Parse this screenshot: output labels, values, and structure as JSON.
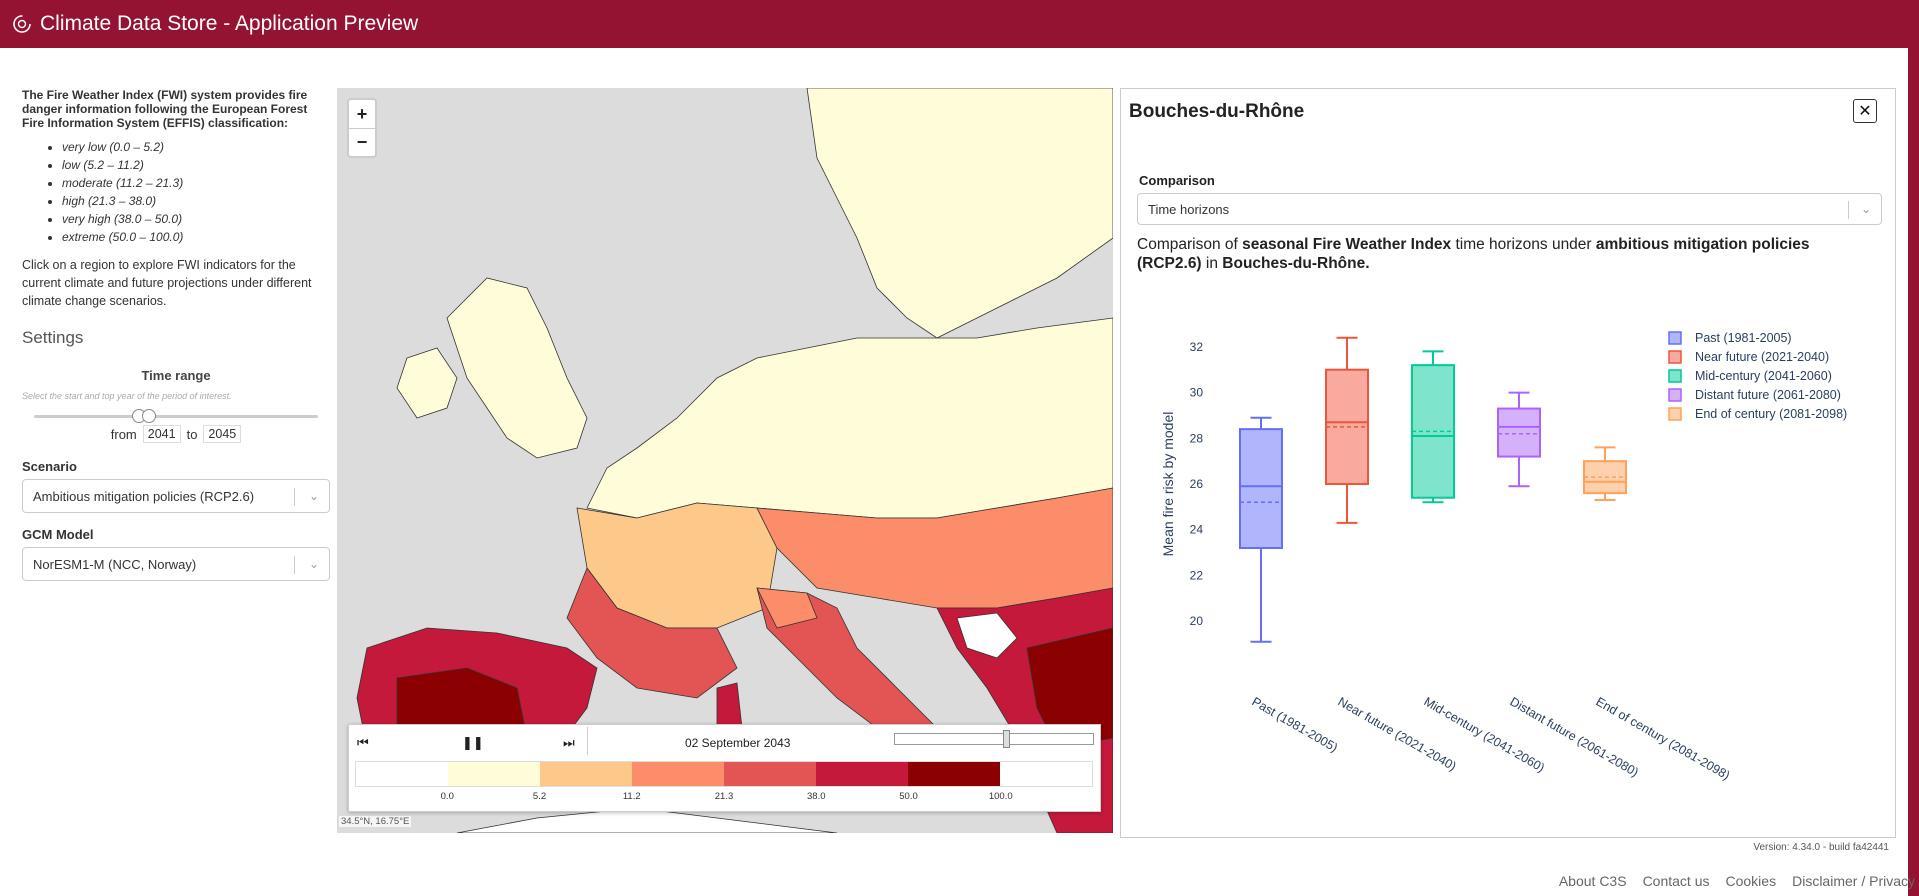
{
  "header": {
    "title": "Climate Data Store - Application Preview"
  },
  "sidebar": {
    "intro": "The Fire Weather Index (FWI) system provides fire danger information following the European Forest Fire Information System (EFFIS) classification:",
    "classes": [
      "very low (0.0 – 5.2)",
      "low (5.2 – 11.2)",
      "moderate (11.2 – 21.3)",
      "high (21.3 – 38.0)",
      "very high (38.0 – 50.0)",
      "extreme (50.0 – 100.0)"
    ],
    "click_text": "Click on a region to explore FWI indicators for the current climate and future projections under different climate change scenarios.",
    "settings_title": "Settings",
    "time_range": {
      "title": "Time range",
      "help": "Select the start and top year of the period of interest.",
      "from_label": "from",
      "to_label": "to",
      "from": "2041",
      "to": "2045"
    },
    "scenario": {
      "label": "Scenario",
      "value": "Ambitious mitigation policies (RCP2.6)"
    },
    "gcm": {
      "label": "GCM Model",
      "value": "NorESM1-M (NCC, Norway)"
    }
  },
  "map": {
    "zoom_in": "+",
    "zoom_out": "−",
    "coords": "34.5°N, 16.75°E",
    "player": {
      "prev_icon": "rewind-icon",
      "pause_icon": "pause-icon",
      "next_icon": "fast-forward-icon",
      "date": "02 September 2043",
      "time_slider_position": 0.57
    },
    "legend": {
      "colors": [
        "#ffffff",
        "#fefcd9",
        "#fdc98b",
        "#fc8d6a",
        "#e35454",
        "#c5193c",
        "#8b0000",
        "#ffffff"
      ],
      "ticks": [
        "0.0",
        "5.2",
        "11.2",
        "21.3",
        "38.0",
        "50.0",
        "100.0"
      ]
    }
  },
  "panel": {
    "title": "Bouches-du-Rhône",
    "close_icon": "close-icon",
    "comparison_label": "Comparison",
    "comparison_value": "Time horizons",
    "heading": {
      "p1": "Comparison of ",
      "b1": "seasonal Fire Weather Index",
      "p2": " time horizons under ",
      "b2": "ambitious mitigation policies (RCP2.6)",
      "p3": " in ",
      "b3": "Bouches-du-Rhône."
    }
  },
  "chart_data": {
    "type": "box",
    "ylabel": "Mean fire risk by model",
    "ylim": [
      19,
      33
    ],
    "yticks": [
      20,
      22,
      24,
      26,
      28,
      30,
      32
    ],
    "legend_position": "top-right",
    "series": [
      {
        "name": "Past (1981-2005)",
        "color": "#636efa",
        "min": 19.1,
        "q1": 23.2,
        "median": 25.9,
        "mean": 25.2,
        "q3": 28.4,
        "max": 28.9
      },
      {
        "name": "Near future (2021-2040)",
        "color": "#ef553b",
        "min": 24.3,
        "q1": 26.0,
        "median": 28.7,
        "mean": 28.5,
        "q3": 31.0,
        "max": 32.4
      },
      {
        "name": "Mid-century (2041-2060)",
        "color": "#00cc96",
        "min": 25.2,
        "q1": 25.4,
        "median": 28.1,
        "mean": 28.3,
        "q3": 31.2,
        "max": 31.8
      },
      {
        "name": "Distant future (2061-2080)",
        "color": "#ab63fa",
        "min": 25.9,
        "q1": 27.2,
        "median": 28.5,
        "mean": 28.2,
        "q3": 29.3,
        "max": 30.0
      },
      {
        "name": "End of century (2081-2098)",
        "color": "#ffa15a",
        "min": 25.3,
        "q1": 25.6,
        "median": 26.1,
        "mean": 26.3,
        "q3": 27.0,
        "max": 27.6
      }
    ]
  },
  "footer": {
    "version": "Version: 4.34.0 - build fa42441",
    "links": [
      "About C3S",
      "Contact us",
      "Cookies",
      "Disclaimer / Privacy"
    ]
  }
}
